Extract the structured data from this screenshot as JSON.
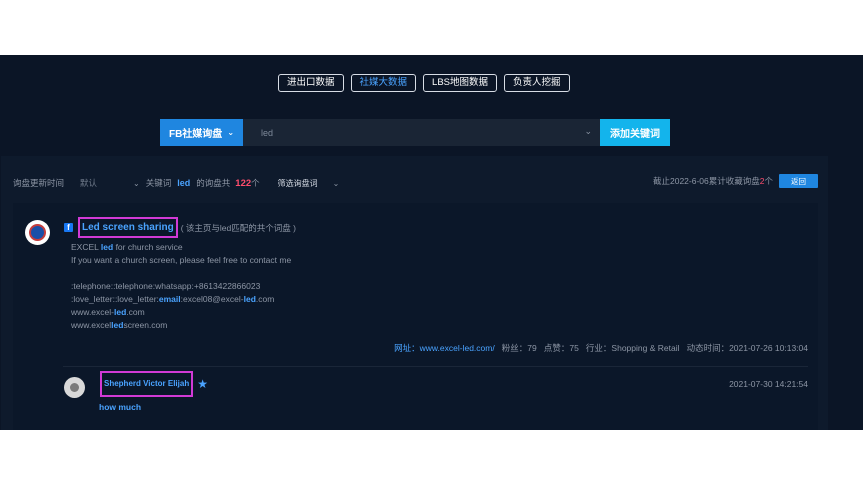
{
  "tabs": [
    {
      "label": "进出口数据"
    },
    {
      "label": "社媒大数据"
    },
    {
      "label": "LBS地图数据"
    },
    {
      "label": "负责人挖掘"
    }
  ],
  "active_tab": "社媒大数据",
  "search": {
    "type_label": "FB社媒询盘",
    "value": "led",
    "add_label": "添加关键词"
  },
  "filter": {
    "update_time_label": "询盘更新时间",
    "update_time_value": "默认",
    "keyword_prefix": "关键词",
    "keyword": "led",
    "count_prefix": "的询盘共",
    "count": "122",
    "count_suffix": "个",
    "sort_label": "筛选询盘词",
    "summary_prefix": "截止2022-6-06累计收藏询盘",
    "summary_count": "2",
    "summary_suffix": "个",
    "back_label": "返回"
  },
  "card": {
    "page_title": "Led screen sharing",
    "page_note": "( 该主页与led匹配的共个词盘 )",
    "desc": {
      "line1_pre": "EXCEL ",
      "line1_hl": "led",
      "line1_post": " for church service",
      "line2": "If you want a church screen, please feel free to contact me",
      "line3": ":telephone::telephone:whatsapp:+8613422866023",
      "line4_pre": ":love_letter::love_letter:",
      "line4_hl": "email",
      "line4_mid": ":excel08@excel-",
      "line4_hl2": "led",
      "line4_post": ".com",
      "line5_pre": "www.excel-",
      "line5_hl": "led",
      "line5_post": ".com",
      "line6_pre": "www.excel",
      "line6_hl": "led",
      "line6_post": "screen.com"
    },
    "meta": {
      "site_label": "网址：",
      "site": "www.excel-led.com/",
      "fans": "粉丝：79",
      "likes": "点赞：75",
      "industry": "行业：Shopping & Retail",
      "time": "动态时间：2021-07-26 10:13:04"
    },
    "comment": {
      "name": "Shepherd Victor Elijah",
      "time": "2021-07-30 14:21:54",
      "text": "how much"
    }
  },
  "colors": {
    "accent": "#1f86e0",
    "add_button": "#13b4ec",
    "highlight_border": "#d23ad6",
    "count_red": "#ff4d6d"
  },
  "icons": [
    "facebook-icon",
    "chevron-down-icon",
    "star-icon"
  ]
}
